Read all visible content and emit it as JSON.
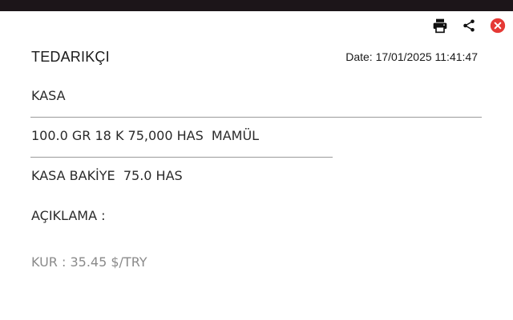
{
  "toolbar": {
    "print_icon": "printer-icon",
    "share_icon": "share-icon",
    "close_icon": "close-circle-icon",
    "close_color": "#e53935"
  },
  "header": {
    "title": "TEDARIKÇI",
    "date_label": "Date: 17/01/2025 11:41:47"
  },
  "body": {
    "kasa": "KASA",
    "item_line": "100.0 GR 18 K 75,000 HAS  MAMÜL",
    "balance_line": "KASA BAKİYE  75.0 HAS",
    "description_label": "AÇIKLAMA :",
    "rate_line": "KUR : 35.45 $/TRY"
  }
}
